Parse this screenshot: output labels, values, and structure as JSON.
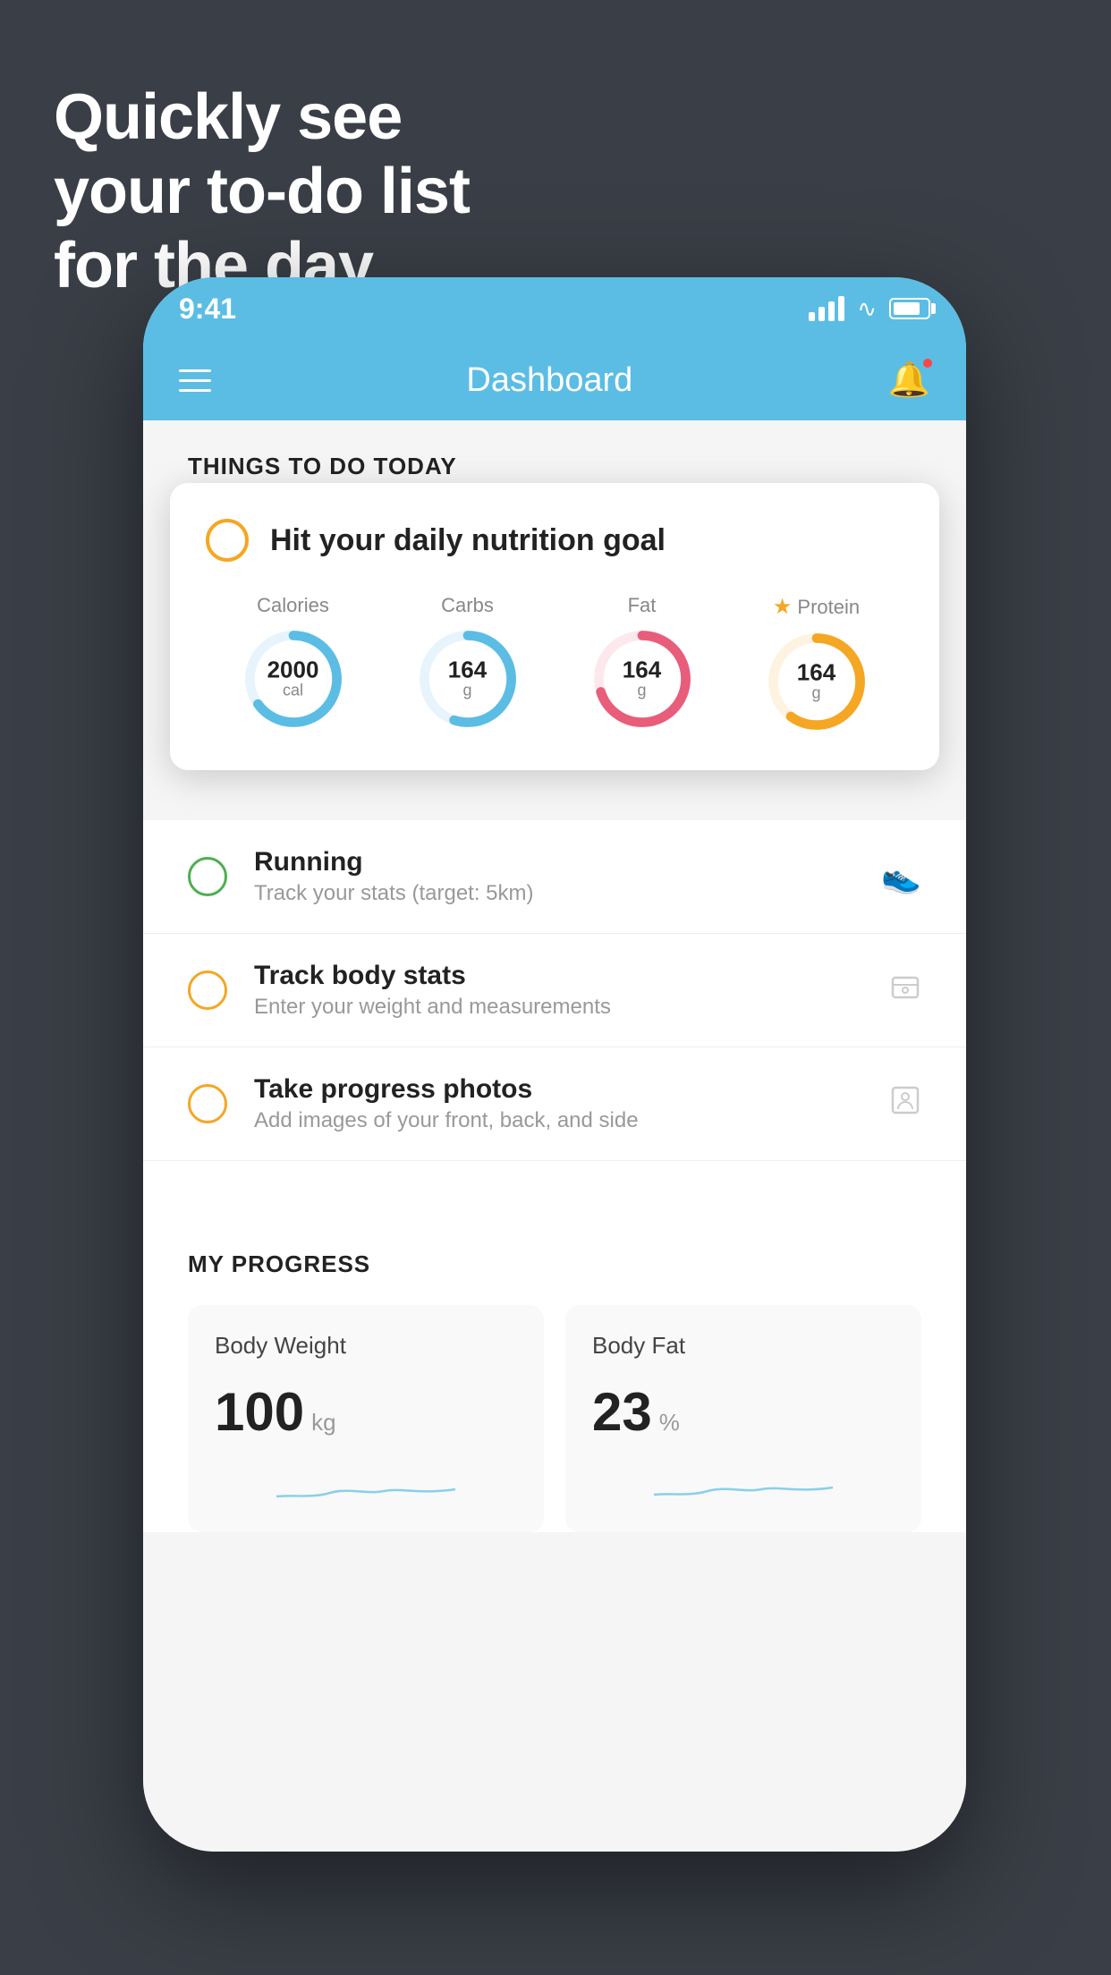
{
  "hero": {
    "line1": "Quickly see",
    "line2": "your to-do list",
    "line3": "for the day."
  },
  "status_bar": {
    "time": "9:41"
  },
  "header": {
    "title": "Dashboard"
  },
  "things_today": {
    "section_title": "THINGS TO DO TODAY",
    "nutrition_card": {
      "title": "Hit your daily nutrition goal",
      "stats": [
        {
          "label": "Calories",
          "value": "2000",
          "unit": "cal",
          "color": "#5bbde4",
          "percent": 65
        },
        {
          "label": "Carbs",
          "value": "164",
          "unit": "g",
          "color": "#5bbde4",
          "percent": 55
        },
        {
          "label": "Fat",
          "value": "164",
          "unit": "g",
          "color": "#e85d7a",
          "percent": 70
        },
        {
          "label": "Protein",
          "value": "164",
          "unit": "g",
          "color": "#f5a623",
          "percent": 60,
          "starred": true
        }
      ]
    },
    "todo_items": [
      {
        "id": "running",
        "main": "Running",
        "sub": "Track your stats (target: 5km)",
        "check_color": "green",
        "icon": "shoe"
      },
      {
        "id": "body-stats",
        "main": "Track body stats",
        "sub": "Enter your weight and measurements",
        "check_color": "yellow",
        "icon": "scale"
      },
      {
        "id": "progress-photos",
        "main": "Take progress photos",
        "sub": "Add images of your front, back, and side",
        "check_color": "yellow",
        "icon": "person"
      }
    ]
  },
  "progress": {
    "section_title": "MY PROGRESS",
    "cards": [
      {
        "id": "body-weight",
        "title": "Body Weight",
        "value": "100",
        "unit": "kg"
      },
      {
        "id": "body-fat",
        "title": "Body Fat",
        "value": "23",
        "unit": "%"
      }
    ]
  }
}
